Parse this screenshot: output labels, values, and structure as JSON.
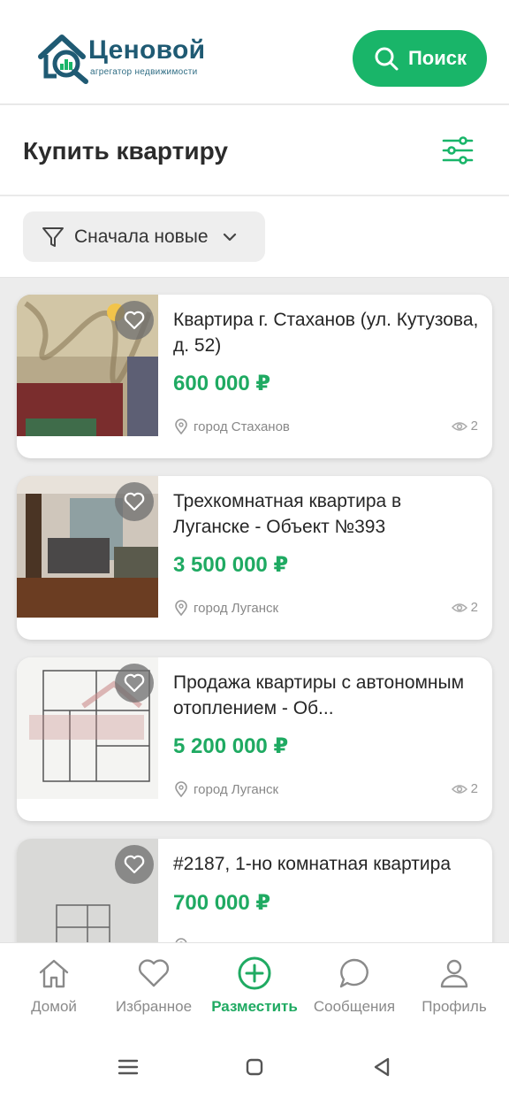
{
  "app": {
    "logo_title": "Ценовой",
    "logo_subtitle": "агрегатор недвижимости",
    "search_label": "Поиск"
  },
  "page": {
    "title": "Купить квартиру",
    "sort_label": "Сначала новые"
  },
  "listings": [
    {
      "title": "Квартира г. Стаханов (ул. Кутузова, д. 52)",
      "price": "600 000 ₽",
      "city": "город Стаханов",
      "views": "2"
    },
    {
      "title": "Трехкомнатная квартира в Луганске - Объект №393",
      "price": "3 500 000 ₽",
      "city": "город Луганск",
      "views": "2"
    },
    {
      "title": "Продажа квартиры с автономным отоплением - Об...",
      "price": "5 200 000 ₽",
      "city": "город Луганск",
      "views": "2"
    },
    {
      "title": "#2187, 1-но комнатная квартира",
      "price": "700 000 ₽",
      "city": "",
      "views": ""
    }
  ],
  "tabs": [
    {
      "label": "Домой",
      "icon": "home-icon"
    },
    {
      "label": "Избранное",
      "icon": "heart-icon"
    },
    {
      "label": "Разместить",
      "icon": "plus-circle-icon",
      "active": true
    },
    {
      "label": "Сообщения",
      "icon": "chat-icon"
    },
    {
      "label": "Профиль",
      "icon": "user-icon"
    }
  ],
  "colors": {
    "accent": "#19b569",
    "price": "#1faa62",
    "brand": "#1f5a73"
  }
}
